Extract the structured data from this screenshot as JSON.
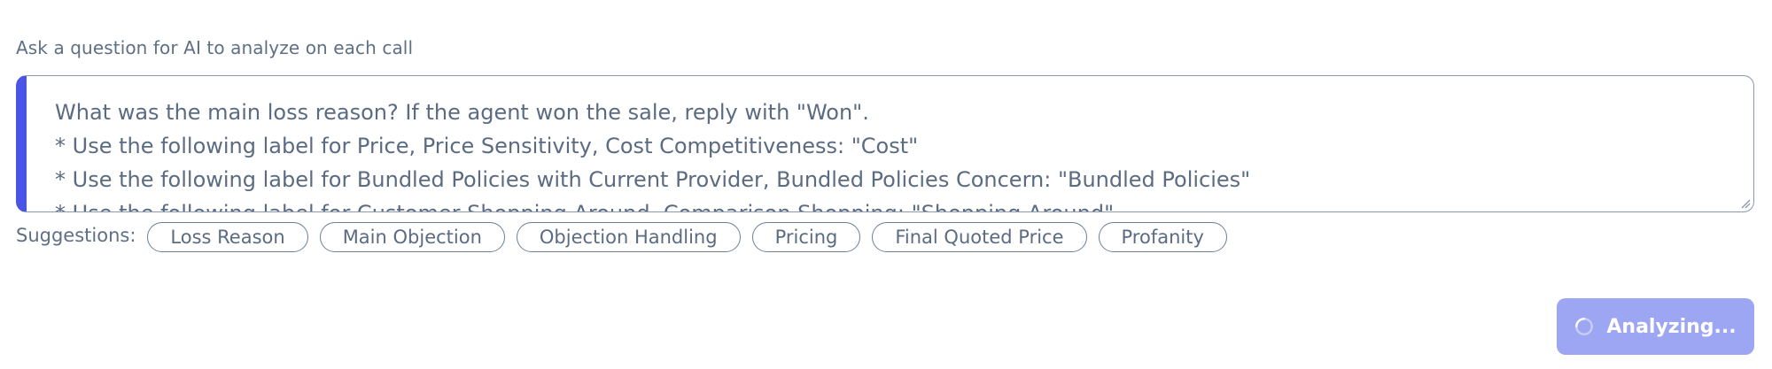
{
  "question": {
    "label": "Ask a question for AI to analyze on each call",
    "text": "What was the main loss reason? If the agent won the sale, reply with \"Won\".\n* Use the following label for Price, Price Sensitivity, Cost Competitiveness: \"Cost\"\n* Use the following label for Bundled Policies with Current Provider, Bundled Policies Concern: \"Bundled Policies\"\n* Use the following label for Customer Shopping Around, Comparison Shopping: \"Shopping Around\""
  },
  "suggestions": {
    "label": "Suggestions:",
    "items": [
      {
        "label": "Loss Reason"
      },
      {
        "label": "Main Objection"
      },
      {
        "label": "Objection Handling"
      },
      {
        "label": "Pricing"
      },
      {
        "label": "Final Quoted Price"
      },
      {
        "label": "Profanity"
      }
    ]
  },
  "analyze_button": {
    "label": "Analyzing...",
    "icon": "spinner-icon"
  },
  "colors": {
    "accent": "#4a55e6",
    "button_disabled": "#9da6f2",
    "text": "#5b6b82",
    "border": "#8a99ad"
  }
}
